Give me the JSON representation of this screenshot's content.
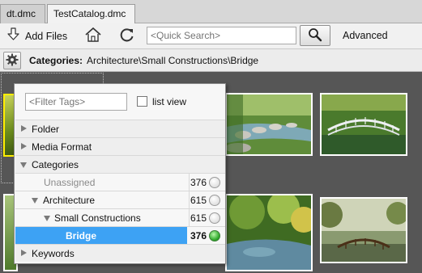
{
  "tabs": [
    {
      "label": "dt.dmc",
      "active": false
    },
    {
      "label": "TestCatalog.dmc",
      "active": true
    }
  ],
  "toolbar": {
    "add_files_label": "Add Files",
    "search_placeholder": "<Quick Search>",
    "advanced_label": "Advanced"
  },
  "pathbar": {
    "label": "Categories:",
    "path": "Architecture\\Small Constructions\\Bridge"
  },
  "popup": {
    "filter_placeholder": "<Filter Tags>",
    "list_view_label": "list view",
    "list_view_checked": false,
    "rows": [
      {
        "label": "Folder",
        "kind": "group",
        "expanded": false
      },
      {
        "label": "Media Format",
        "kind": "group",
        "expanded": false
      },
      {
        "label": "Categories",
        "kind": "group",
        "expanded": true
      },
      {
        "label": "Unassigned",
        "kind": "item",
        "count": "376",
        "dimmed": true
      },
      {
        "label": "Architecture",
        "kind": "item",
        "count": "615",
        "expanded": true
      },
      {
        "label": "Small Constructions",
        "kind": "item",
        "count": "615",
        "expanded": true
      },
      {
        "label": "Bridge",
        "kind": "item",
        "count": "376",
        "selected": true
      },
      {
        "label": "Keywords",
        "kind": "group",
        "expanded": false
      }
    ]
  },
  "colors": {
    "selection": "#3da2f4",
    "thumb_selected_border": "#ffee00",
    "active_indicator": "#2ea82a"
  }
}
